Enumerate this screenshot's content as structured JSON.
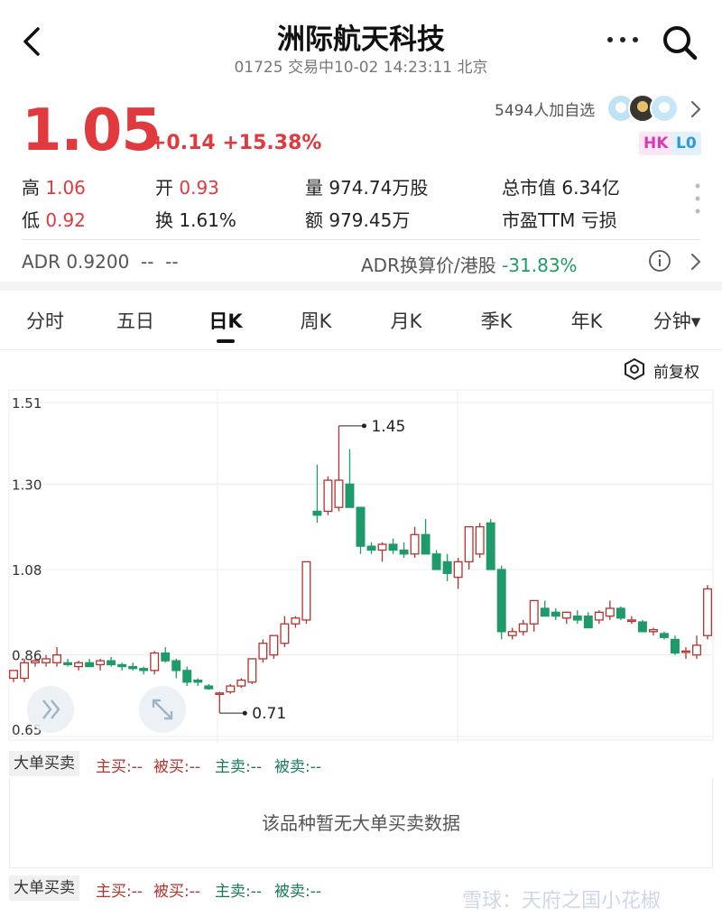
{
  "header": {
    "title": "洲际航天科技",
    "subtitle": "01725 交易中10-02 14:23:11 北京"
  },
  "quote": {
    "price": "1.05",
    "change": "+0.14 +15.38%",
    "watchers": "5494人加自选",
    "badge_hk": "HK",
    "badge_l0": "L0"
  },
  "stats": {
    "high_label": "高",
    "high_value": "1.06",
    "open_label": "开",
    "open_value": "0.93",
    "volume": "量 974.74万股",
    "mktcap": "总市值 6.34亿",
    "low_label": "低",
    "low_value": "0.92",
    "turnover": "换 1.61%",
    "amount": "额 979.45万",
    "pe": "市盈TTM 亏损"
  },
  "adr": {
    "left": "ADR 0.9200  --  --",
    "mid_label": "ADR换算价/港股",
    "mid_value": "-31.83%"
  },
  "tabs": [
    "分时",
    "五日",
    "日K",
    "周K",
    "月K",
    "季K",
    "年K",
    "分钟▾"
  ],
  "active_tab": "日K",
  "adjust_label": "前复权",
  "colors": {
    "up": "#e0393e",
    "down": "#1a9e63",
    "candle_up": "#b5322e",
    "candle_down": "#1f9a6a"
  },
  "chart_data": {
    "type": "candlestick",
    "y_ticks": [
      "1.51",
      "1.30",
      "1.08",
      "0.86",
      "0.65"
    ],
    "ylim": [
      0.65,
      1.51
    ],
    "annotations": [
      {
        "label": "1.45",
        "value": 1.45
      },
      {
        "label": "0.71",
        "value": 0.71
      }
    ],
    "candles": [
      {
        "o": 0.8,
        "h": 0.82,
        "l": 0.79,
        "c": 0.82
      },
      {
        "o": 0.8,
        "h": 0.85,
        "l": 0.79,
        "c": 0.84
      },
      {
        "o": 0.84,
        "h": 0.85,
        "l": 0.83,
        "c": 0.845
      },
      {
        "o": 0.84,
        "h": 0.86,
        "l": 0.83,
        "c": 0.85
      },
      {
        "o": 0.84,
        "h": 0.88,
        "l": 0.83,
        "c": 0.86
      },
      {
        "o": 0.84,
        "h": 0.85,
        "l": 0.83,
        "c": 0.835
      },
      {
        "o": 0.83,
        "h": 0.845,
        "l": 0.82,
        "c": 0.84
      },
      {
        "o": 0.84,
        "h": 0.85,
        "l": 0.83,
        "c": 0.83
      },
      {
        "o": 0.835,
        "h": 0.85,
        "l": 0.82,
        "c": 0.845
      },
      {
        "o": 0.845,
        "h": 0.855,
        "l": 0.83,
        "c": 0.835
      },
      {
        "o": 0.835,
        "h": 0.84,
        "l": 0.82,
        "c": 0.83
      },
      {
        "o": 0.83,
        "h": 0.84,
        "l": 0.82,
        "c": 0.825
      },
      {
        "o": 0.825,
        "h": 0.83,
        "l": 0.81,
        "c": 0.82
      },
      {
        "o": 0.82,
        "h": 0.87,
        "l": 0.81,
        "c": 0.865
      },
      {
        "o": 0.865,
        "h": 0.88,
        "l": 0.84,
        "c": 0.845
      },
      {
        "o": 0.845,
        "h": 0.85,
        "l": 0.8,
        "c": 0.82
      },
      {
        "o": 0.82,
        "h": 0.83,
        "l": 0.78,
        "c": 0.79
      },
      {
        "o": 0.795,
        "h": 0.8,
        "l": 0.78,
        "c": 0.79
      },
      {
        "o": 0.78,
        "h": 0.785,
        "l": 0.77,
        "c": 0.773
      },
      {
        "o": 0.76,
        "h": 0.765,
        "l": 0.71,
        "c": 0.762
      },
      {
        "o": 0.765,
        "h": 0.785,
        "l": 0.76,
        "c": 0.78
      },
      {
        "o": 0.78,
        "h": 0.8,
        "l": 0.775,
        "c": 0.795
      },
      {
        "o": 0.79,
        "h": 0.85,
        "l": 0.785,
        "c": 0.85
      },
      {
        "o": 0.85,
        "h": 0.9,
        "l": 0.84,
        "c": 0.89
      },
      {
        "o": 0.86,
        "h": 0.91,
        "l": 0.85,
        "c": 0.91
      },
      {
        "o": 0.89,
        "h": 0.96,
        "l": 0.88,
        "c": 0.94
      },
      {
        "o": 0.94,
        "h": 0.96,
        "l": 0.93,
        "c": 0.955
      },
      {
        "o": 0.95,
        "h": 1.1,
        "l": 0.94,
        "c": 1.1
      },
      {
        "o": 1.23,
        "h": 1.35,
        "l": 1.2,
        "c": 1.22
      },
      {
        "o": 1.23,
        "h": 1.32,
        "l": 1.22,
        "c": 1.31
      },
      {
        "o": 1.24,
        "h": 1.45,
        "l": 1.23,
        "c": 1.31
      },
      {
        "o": 1.3,
        "h": 1.39,
        "l": 1.24,
        "c": 1.24
      },
      {
        "o": 1.24,
        "h": 1.24,
        "l": 1.12,
        "c": 1.14
      },
      {
        "o": 1.14,
        "h": 1.15,
        "l": 1.12,
        "c": 1.13
      },
      {
        "o": 1.13,
        "h": 1.15,
        "l": 1.1,
        "c": 1.145
      },
      {
        "o": 1.145,
        "h": 1.16,
        "l": 1.12,
        "c": 1.13
      },
      {
        "o": 1.13,
        "h": 1.15,
        "l": 1.11,
        "c": 1.12
      },
      {
        "o": 1.12,
        "h": 1.19,
        "l": 1.11,
        "c": 1.17
      },
      {
        "o": 1.17,
        "h": 1.21,
        "l": 1.16,
        "c": 1.12
      },
      {
        "o": 1.12,
        "h": 1.13,
        "l": 1.1,
        "c": 1.08
      },
      {
        "o": 1.1,
        "h": 1.12,
        "l": 1.05,
        "c": 1.07
      },
      {
        "o": 1.06,
        "h": 1.11,
        "l": 1.03,
        "c": 1.1
      },
      {
        "o": 1.1,
        "h": 1.17,
        "l": 1.08,
        "c": 1.19
      },
      {
        "o": 1.12,
        "h": 1.2,
        "l": 1.11,
        "c": 1.19
      },
      {
        "o": 1.2,
        "h": 1.21,
        "l": 1.08,
        "c": 1.08
      },
      {
        "o": 1.08,
        "h": 1.09,
        "l": 0.9,
        "c": 0.92
      },
      {
        "o": 0.91,
        "h": 0.93,
        "l": 0.9,
        "c": 0.92
      },
      {
        "o": 0.92,
        "h": 0.95,
        "l": 0.91,
        "c": 0.94
      },
      {
        "o": 0.94,
        "h": 1.0,
        "l": 0.92,
        "c": 1.0
      },
      {
        "o": 0.98,
        "h": 1.0,
        "l": 0.96,
        "c": 0.96
      },
      {
        "o": 0.97,
        "h": 0.98,
        "l": 0.95,
        "c": 0.96
      },
      {
        "o": 0.955,
        "h": 0.97,
        "l": 0.94,
        "c": 0.97
      },
      {
        "o": 0.96,
        "h": 0.975,
        "l": 0.94,
        "c": 0.95
      },
      {
        "o": 0.96,
        "h": 0.97,
        "l": 0.93,
        "c": 0.93
      },
      {
        "o": 0.95,
        "h": 0.975,
        "l": 0.94,
        "c": 0.97
      },
      {
        "o": 0.96,
        "h": 1.0,
        "l": 0.95,
        "c": 0.98
      },
      {
        "o": 0.98,
        "h": 0.985,
        "l": 0.95,
        "c": 0.955
      },
      {
        "o": 0.95,
        "h": 0.96,
        "l": 0.94,
        "c": 0.95
      },
      {
        "o": 0.945,
        "h": 0.95,
        "l": 0.92,
        "c": 0.92
      },
      {
        "o": 0.92,
        "h": 0.93,
        "l": 0.91,
        "c": 0.925
      },
      {
        "o": 0.915,
        "h": 0.92,
        "l": 0.9,
        "c": 0.905
      },
      {
        "o": 0.9,
        "h": 0.91,
        "l": 0.86,
        "c": 0.865
      },
      {
        "o": 0.87,
        "h": 0.88,
        "l": 0.85,
        "c": 0.87
      },
      {
        "o": 0.86,
        "h": 0.91,
        "l": 0.85,
        "c": 0.885
      },
      {
        "o": 0.91,
        "h": 1.04,
        "l": 0.9,
        "c": 1.03
      }
    ]
  },
  "funds": {
    "tag": "大单买卖",
    "main_buy": "主买:--",
    "passive_buy": "被买:--",
    "main_sell": "主卖:--",
    "passive_sell": "被卖:--",
    "empty": "该品种暂无大单买卖数据"
  },
  "watermark": "雪球：天府之国小花椒"
}
